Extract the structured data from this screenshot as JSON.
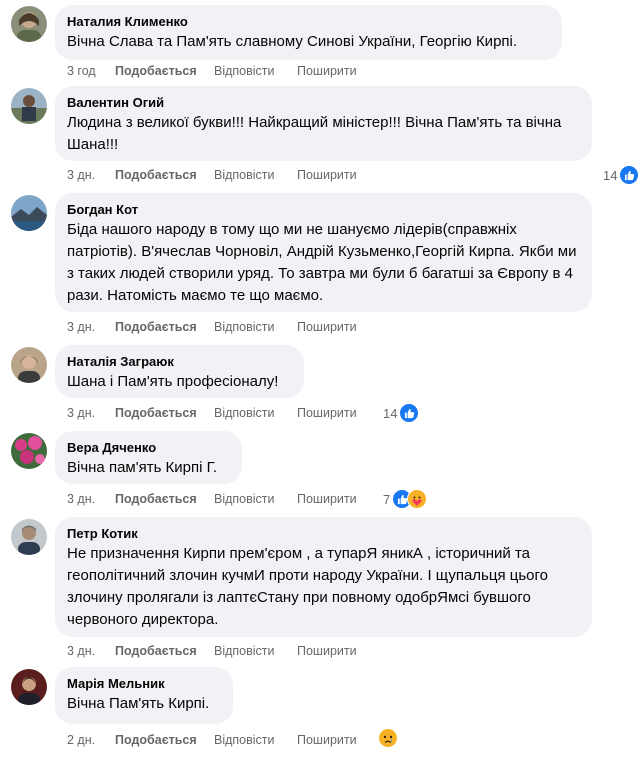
{
  "actions": {
    "like": "Подобається",
    "reply": "Відповісти",
    "share": "Поширити"
  },
  "colors": {
    "bubble": "#f0f2f5",
    "meta": "#65676b",
    "like_reaction": "#1877f2",
    "emoji": "#f7b125"
  },
  "comments": [
    {
      "author": "Наталия Клименко",
      "text": "Вічна Слава та Пам'ять славному Синові України, Георгію Кирпі.",
      "time": "3 год"
    },
    {
      "author": "Валентин Огий",
      "text": "Людина з великої букви!!! Найкращий міністер!!! Вічна Пам'ять та вічна Шана!!!",
      "time": "3 дн.",
      "reaction_count": "14",
      "reactions": [
        "like-icon"
      ]
    },
    {
      "author": "Богдан Кот",
      "text": "Біда нашого народу в тому що ми не шануємо лідерів(справжніх патріотів). В'ячеслав Чорновіл, Андрій Кузьменко,Георгій Кирпа. Якби ми з таких людей створили уряд. То завтра ми були б багатші за Європу в 4 рази. Натомість маємо те що маємо.",
      "time": "3 дн."
    },
    {
      "author": "Наталія Заграюк",
      "text": "Шана і Пам'ять професіоналу!",
      "time": "3 дн.",
      "reaction_count": "14",
      "reactions": [
        "like-icon"
      ]
    },
    {
      "author": "Вера Дяченко",
      "text": "Вічна пам'ять Кирпі Г.",
      "time": "3 дн.",
      "reaction_count": "7",
      "reactions": [
        "like-icon",
        "care-icon"
      ]
    },
    {
      "author": "Петр Котик",
      "text": "Не призначення Кирпи прем'єром , а тупарЯ яникА , історичний та геополітичний злочин кучмИ проти народу України. І щупальця цього злочину пролягали із лаптєСтану при повному одобрЯмсі бувшого червоного директора.",
      "time": "3 дн."
    },
    {
      "author": "Марія Мельник",
      "text": "Вічна Пам'ять Кирпі.",
      "time": "2 дн.",
      "reactions": [
        "sad-icon"
      ]
    }
  ]
}
